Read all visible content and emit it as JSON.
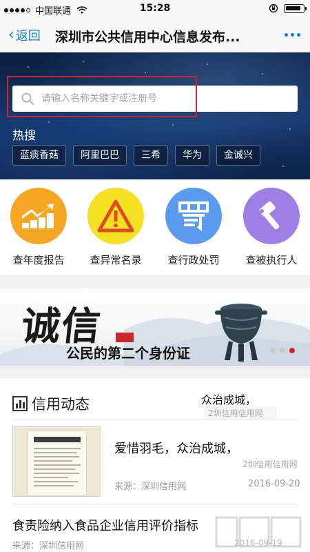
{
  "status_bar": {
    "carrier": "中国联通",
    "time": "15:28"
  },
  "nav": {
    "back_label": "返回",
    "title": "深圳市公共信用中心信息发布..."
  },
  "search": {
    "placeholder": "请输入名称关键字或注册号",
    "hot_label": "热搜",
    "hot_tags": [
      "蓝痰香菇",
      "阿里巴巴",
      "三希",
      "华为",
      "金诚兴"
    ]
  },
  "quick_actions": [
    {
      "label": "查年度报告",
      "color": "#f6a623",
      "icon": "chart-up-icon"
    },
    {
      "label": "查异常名录",
      "color": "#f5e021",
      "icon": "warning-icon"
    },
    {
      "label": "查行政处罚",
      "color": "#5b9bef",
      "icon": "penalty-icon"
    },
    {
      "label": "查被执行人",
      "color": "#9e7fe6",
      "icon": "gavel-icon"
    }
  ],
  "banner": {
    "calligraphy": "诚信",
    "subtitle": "公民的第二个身份证"
  },
  "news": {
    "section_title": "信用动态",
    "overlay_title": "众治成城，",
    "overlay_faded": "2圳信用信用网",
    "items": [
      {
        "title": "爱惜羽毛，众治成城，",
        "faded": "2圳信用信用网",
        "source": "来源：深圳信用网",
        "date": "2016-09-20"
      },
      {
        "title": "食责险纳入食品企业信用评价指标",
        "source": "来源：深圳信用网",
        "date": "2016-09-19"
      }
    ]
  },
  "colors": {
    "accent": "#1a7ee0",
    "highlight": "#d8202a"
  }
}
